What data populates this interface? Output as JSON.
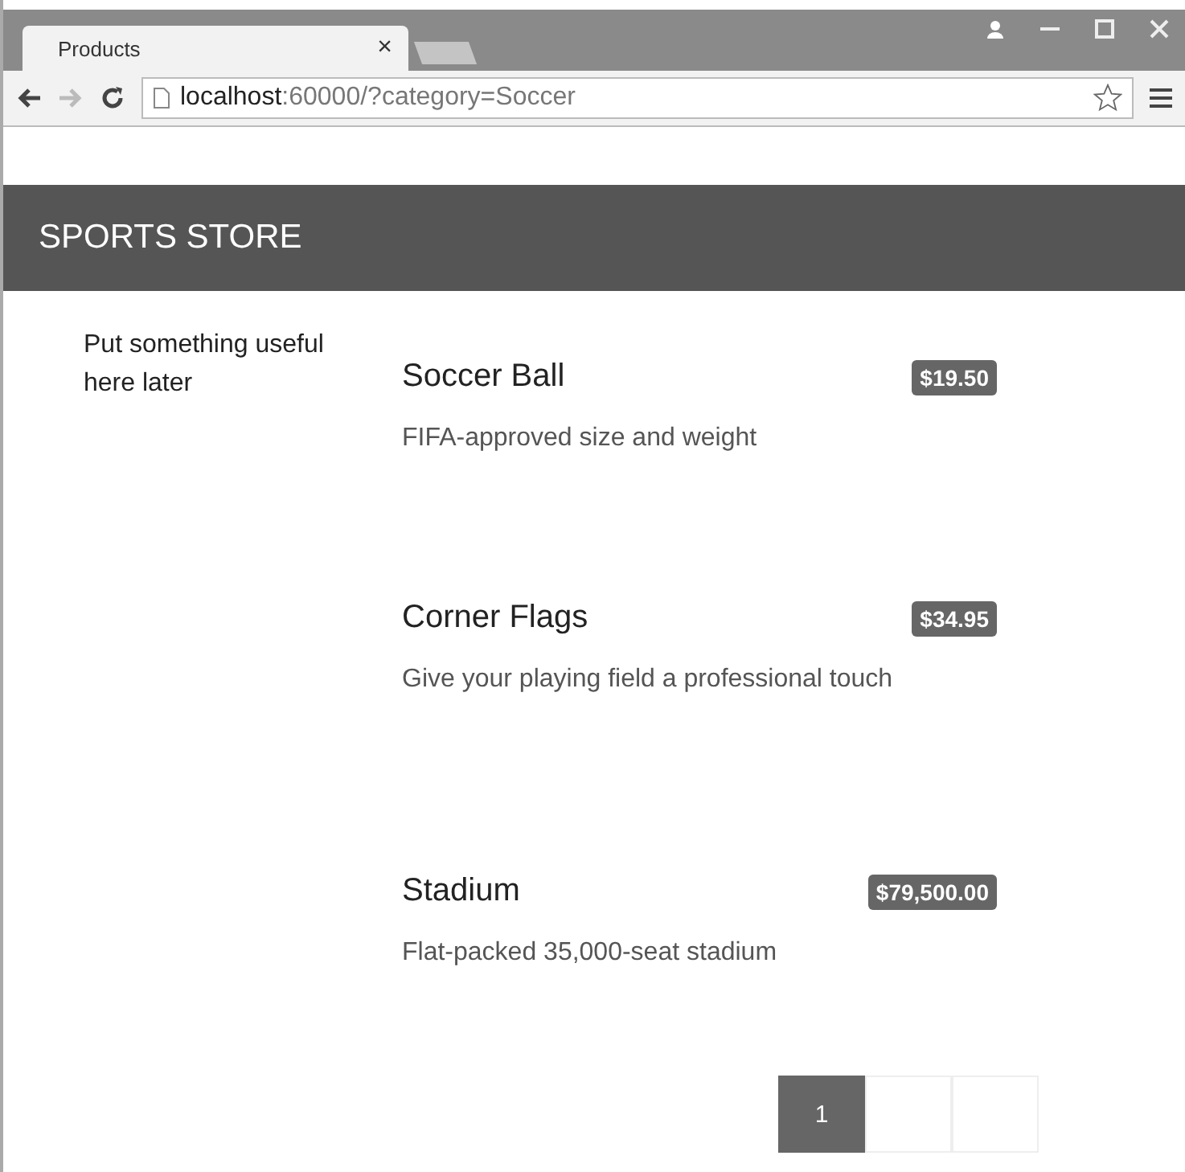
{
  "browser": {
    "tab_title": "Products",
    "tab_close": "×",
    "url_host": "localhost",
    "url_rest": ":60000/?category=Soccer"
  },
  "navbar": {
    "brand": "SPORTS STORE"
  },
  "sidebar": {
    "text": "Put something useful here later"
  },
  "products": [
    {
      "name": "Soccer Ball",
      "price": "$19.50",
      "description": "FIFA-approved size and weight"
    },
    {
      "name": "Corner Flags",
      "price": "$34.95",
      "description": "Give your playing field a professional touch"
    },
    {
      "name": "Stadium",
      "price": "$79,500.00",
      "description": "Flat-packed 35,000-seat stadium"
    }
  ],
  "pagination": [
    {
      "label": "1",
      "selected": true
    },
    {
      "selected": false
    },
    {
      "selected": false
    }
  ]
}
